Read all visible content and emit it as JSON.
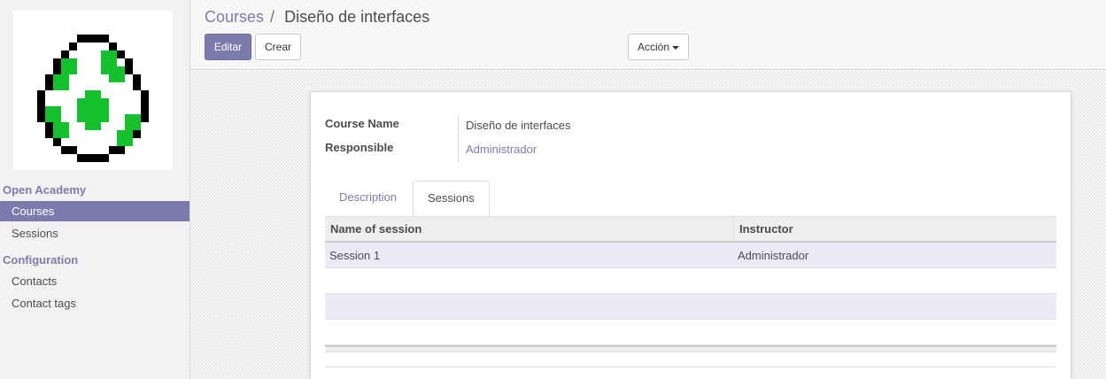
{
  "sidebar": {
    "logo_alt": "egg-logo",
    "sections": [
      {
        "title": "Open Academy",
        "items": [
          {
            "label": "Courses",
            "active": true
          },
          {
            "label": "Sessions",
            "active": false
          }
        ]
      },
      {
        "title": "Configuration",
        "items": [
          {
            "label": "Contacts",
            "active": false
          },
          {
            "label": "Contact tags",
            "active": false
          }
        ]
      }
    ]
  },
  "breadcrumb": {
    "parent": "Courses",
    "separator": "/",
    "current": "Diseño de interfaces"
  },
  "buttons": {
    "edit": "Editar",
    "create": "Crear",
    "action": "Acción"
  },
  "form": {
    "fields": [
      {
        "label": "Course Name",
        "value": "Diseño de interfaces",
        "is_link": false
      },
      {
        "label": "Responsible",
        "value": "Administrador",
        "is_link": true
      }
    ],
    "tabs": [
      {
        "label": "Description",
        "active": false
      },
      {
        "label": "Sessions",
        "active": true
      }
    ],
    "sessions_table": {
      "columns": [
        "Name of session",
        "Instructor"
      ],
      "rows": [
        {
          "name": "Session 1",
          "instructor": "Administrador"
        }
      ]
    }
  },
  "colors": {
    "accent": "#7c7bad",
    "egg_green": "#12c12b"
  }
}
